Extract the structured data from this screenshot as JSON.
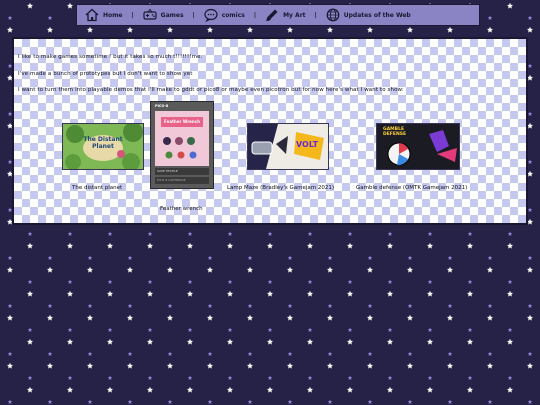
{
  "nav": {
    "items": [
      {
        "label": "Home",
        "icon": "house-icon"
      },
      {
        "label": "Games",
        "icon": "gamepad-icon"
      },
      {
        "label": "comics",
        "icon": "speech-bubble-icon"
      },
      {
        "label": "My Art",
        "icon": "brush-icon"
      },
      {
        "label": "Updates of the Web",
        "icon": "globe-icon"
      }
    ],
    "separator": "|"
  },
  "content": {
    "paragraphs": [
      "I like to make games sometime ! but it takes so much t!!!!!!!me.",
      "I've made a bunch of prototypes but I don't want to show yet",
      "I want to turn them into playable demos that I'll make to gddt or pico8 or maybe even picotron but for now here's what I want to show:"
    ],
    "games": [
      {
        "title": "The distant planet",
        "thumb_title": "The Distant Planet",
        "accent": "#5c9a3a"
      },
      {
        "title": "Feather wrench",
        "thumb_title": "Feather Wrench",
        "window_label": "PICO-8",
        "status_lines": [
          "SAVE TEXTILE",
          "PICO-8 CARTRIDGE"
        ],
        "accent": "#f0a0b8"
      },
      {
        "title": "Lamp Maze (Bradley's Gamejam 2021)",
        "thumb_title": "VOLT",
        "accent": "#f5b81c"
      },
      {
        "title": "Gamble defense (OMTK Gamejam 2021)",
        "thumb_title": "GAMBLE DEFENSE",
        "accent": "#e23a4a"
      }
    ]
  },
  "colors": {
    "background": "#262247",
    "nav_bar": "#8a84c4",
    "checker": "#c5c8ef",
    "star_white": "#ffffff",
    "star_lilac": "#8f88d9"
  }
}
